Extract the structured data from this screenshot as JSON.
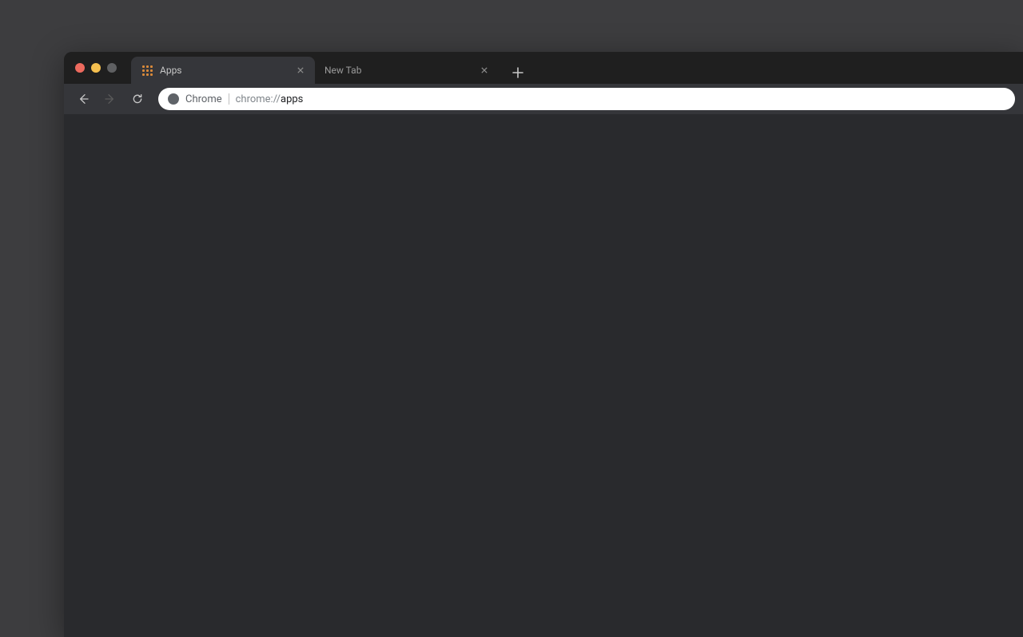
{
  "window": {
    "traffic_lights": {
      "close": "#ed6a5e",
      "min": "#f5bf4f",
      "max": "#5f6062"
    }
  },
  "tabs": [
    {
      "title": "Apps",
      "active": true,
      "icon": "apps-grid-icon"
    },
    {
      "title": "New Tab",
      "active": false,
      "icon": ""
    }
  ],
  "toolbar": {
    "omnibox": {
      "security_label": "Chrome",
      "url_prefix": "chrome://",
      "url_path": "apps"
    }
  }
}
